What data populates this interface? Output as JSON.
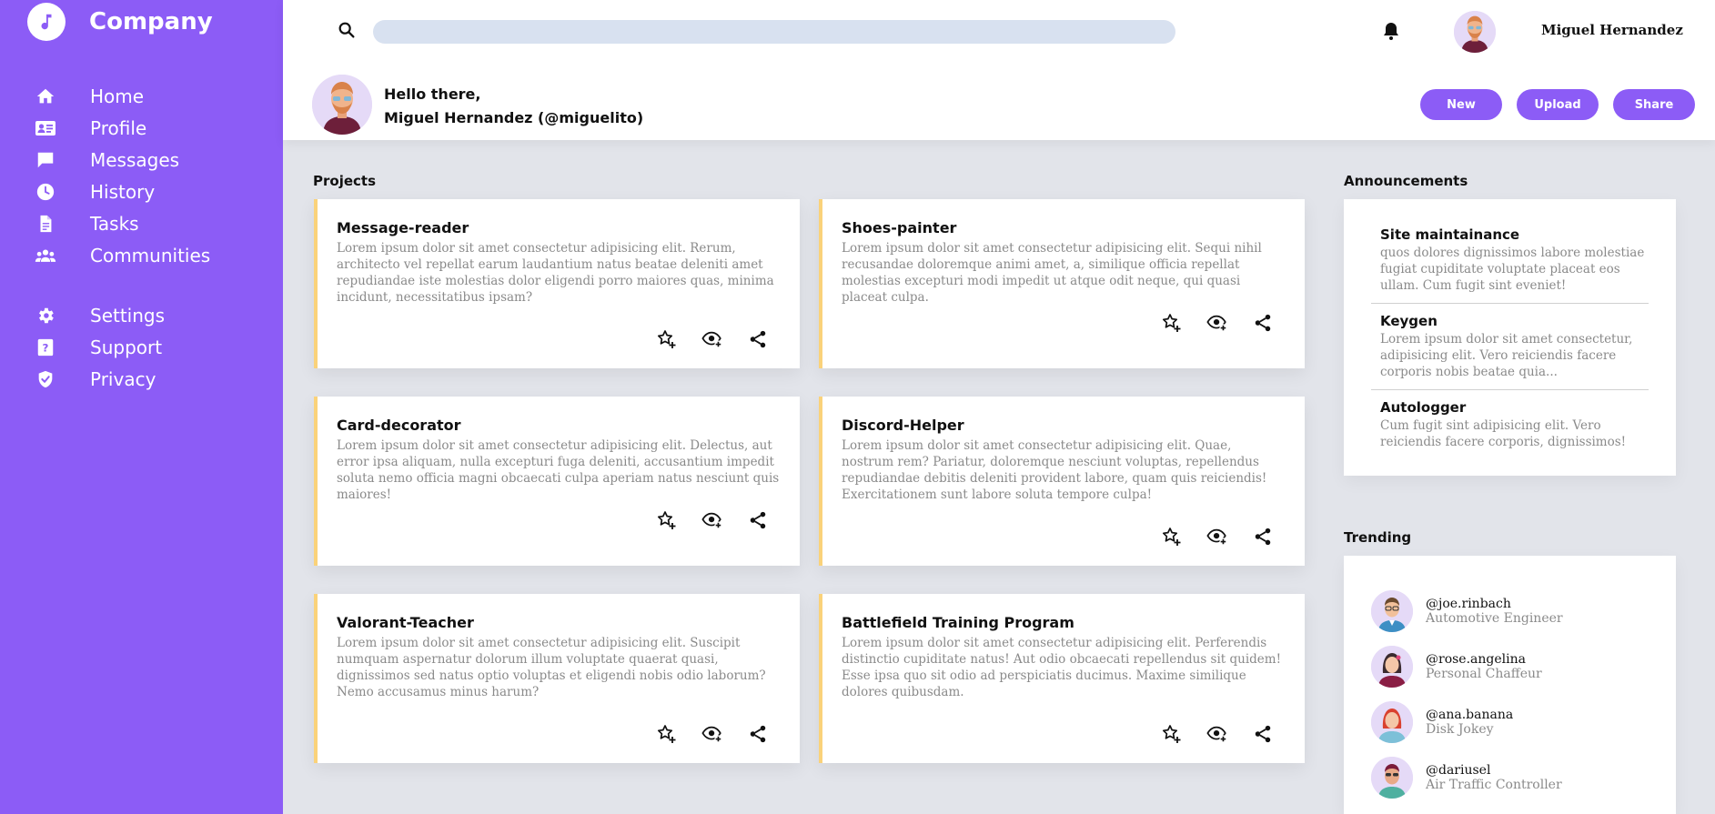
{
  "brand": {
    "name": "Company",
    "logo_icon": "music-note-icon"
  },
  "sidebar": {
    "items": [
      {
        "label": "Home",
        "icon": "home-icon"
      },
      {
        "label": "Profile",
        "icon": "id-card-icon"
      },
      {
        "label": "Messages",
        "icon": "chat-icon"
      },
      {
        "label": "History",
        "icon": "clock-icon"
      },
      {
        "label": "Tasks",
        "icon": "document-icon"
      },
      {
        "label": "Communities",
        "icon": "users-icon"
      },
      {
        "label": "Settings",
        "icon": "gear-icon"
      },
      {
        "label": "Support",
        "icon": "help-icon"
      },
      {
        "label": "Privacy",
        "icon": "shield-icon"
      }
    ]
  },
  "header": {
    "search_placeholder": "",
    "username": "Miguel Hernandez",
    "greeting_line1": "Hello there,",
    "greeting_line2": "Miguel Hernandez (@miguelito)",
    "actions": {
      "new": "New",
      "upload": "Upload",
      "share": "Share"
    }
  },
  "projects": {
    "title": "Projects",
    "items": [
      {
        "title": "Message-reader",
        "desc": "Lorem ipsum dolor sit amet consectetur adipisicing elit. Rerum, architecto vel repellat earum laudantium natus beatae deleniti amet repudiandae iste molestias dolor eligendi porro maiores quas, minima incidunt, necessitatibus ipsam?"
      },
      {
        "title": "Shoes-painter",
        "desc": "Lorem ipsum dolor sit amet consectetur adipisicing elit. Sequi nihil recusandae doloremque animi amet, a, similique officia repellat molestias excepturi modi impedit ut atque odit neque, qui quasi placeat culpa."
      },
      {
        "title": "Card-decorator",
        "desc": "Lorem ipsum dolor sit amet consectetur adipisicing elit. Delectus, aut error ipsa aliquam, nulla excepturi fuga deleniti, accusantium impedit soluta nemo officia magni obcaecati culpa aperiam natus nesciunt quis maiores!"
      },
      {
        "title": "Discord-Helper",
        "desc": "Lorem ipsum dolor sit amet consectetur adipisicing elit. Quae, nostrum rem? Pariatur, doloremque nesciunt voluptas, repellendus repudiandae debitis deleniti provident labore, quam quis reiciendis! Exercitationem sunt labore soluta tempore culpa!"
      },
      {
        "title": "Valorant-Teacher",
        "desc": "Lorem ipsum dolor sit amet consectetur adipisicing elit. Suscipit numquam aspernatur dolorum illum voluptate quaerat quasi, dignissimos sed natus optio voluptas et eligendi nobis odio laborum? Nemo accusamus minus harum?"
      },
      {
        "title": "Battlefield Training Program",
        "desc": "Lorem ipsum dolor sit amet consectetur adipisicing elit. Perferendis distinctio cupiditate natus! Aut odio obcaecati repellendus sit quidem! Esse ipsa quo sit odio ad perspiciatis ducimus. Maxime similique dolores quibusdam."
      }
    ]
  },
  "announcements": {
    "title": "Announcements",
    "items": [
      {
        "title": "Site maintainance",
        "text": "quos dolores dignissimos labore molestiae fugiat cupiditate voluptate placeat eos ullam. Cum fugit sint eveniet!"
      },
      {
        "title": "Keygen",
        "text": "Lorem ipsum dolor sit amet consectetur, adipisicing elit. Vero reiciendis facere corporis nobis beatae quia..."
      },
      {
        "title": "Autologger",
        "text": "Cum fugit sint adipisicing elit. Vero reiciendis facere corporis, dignissimos!"
      }
    ]
  },
  "trending": {
    "title": "Trending",
    "items": [
      {
        "handle": "@joe.rinbach",
        "role": "Automotive Engineer"
      },
      {
        "handle": "@rose.angelina",
        "role": "Personal Chaffeur"
      },
      {
        "handle": "@ana.banana",
        "role": "Disk Jokey"
      },
      {
        "handle": "@dariusel",
        "role": "Air Traffic Controller"
      }
    ]
  },
  "colors": {
    "accent": "#8c5cf6",
    "card_border": "#fad27a",
    "search_bg": "#d8e1f0",
    "page_bg": "#e2e4ea"
  }
}
